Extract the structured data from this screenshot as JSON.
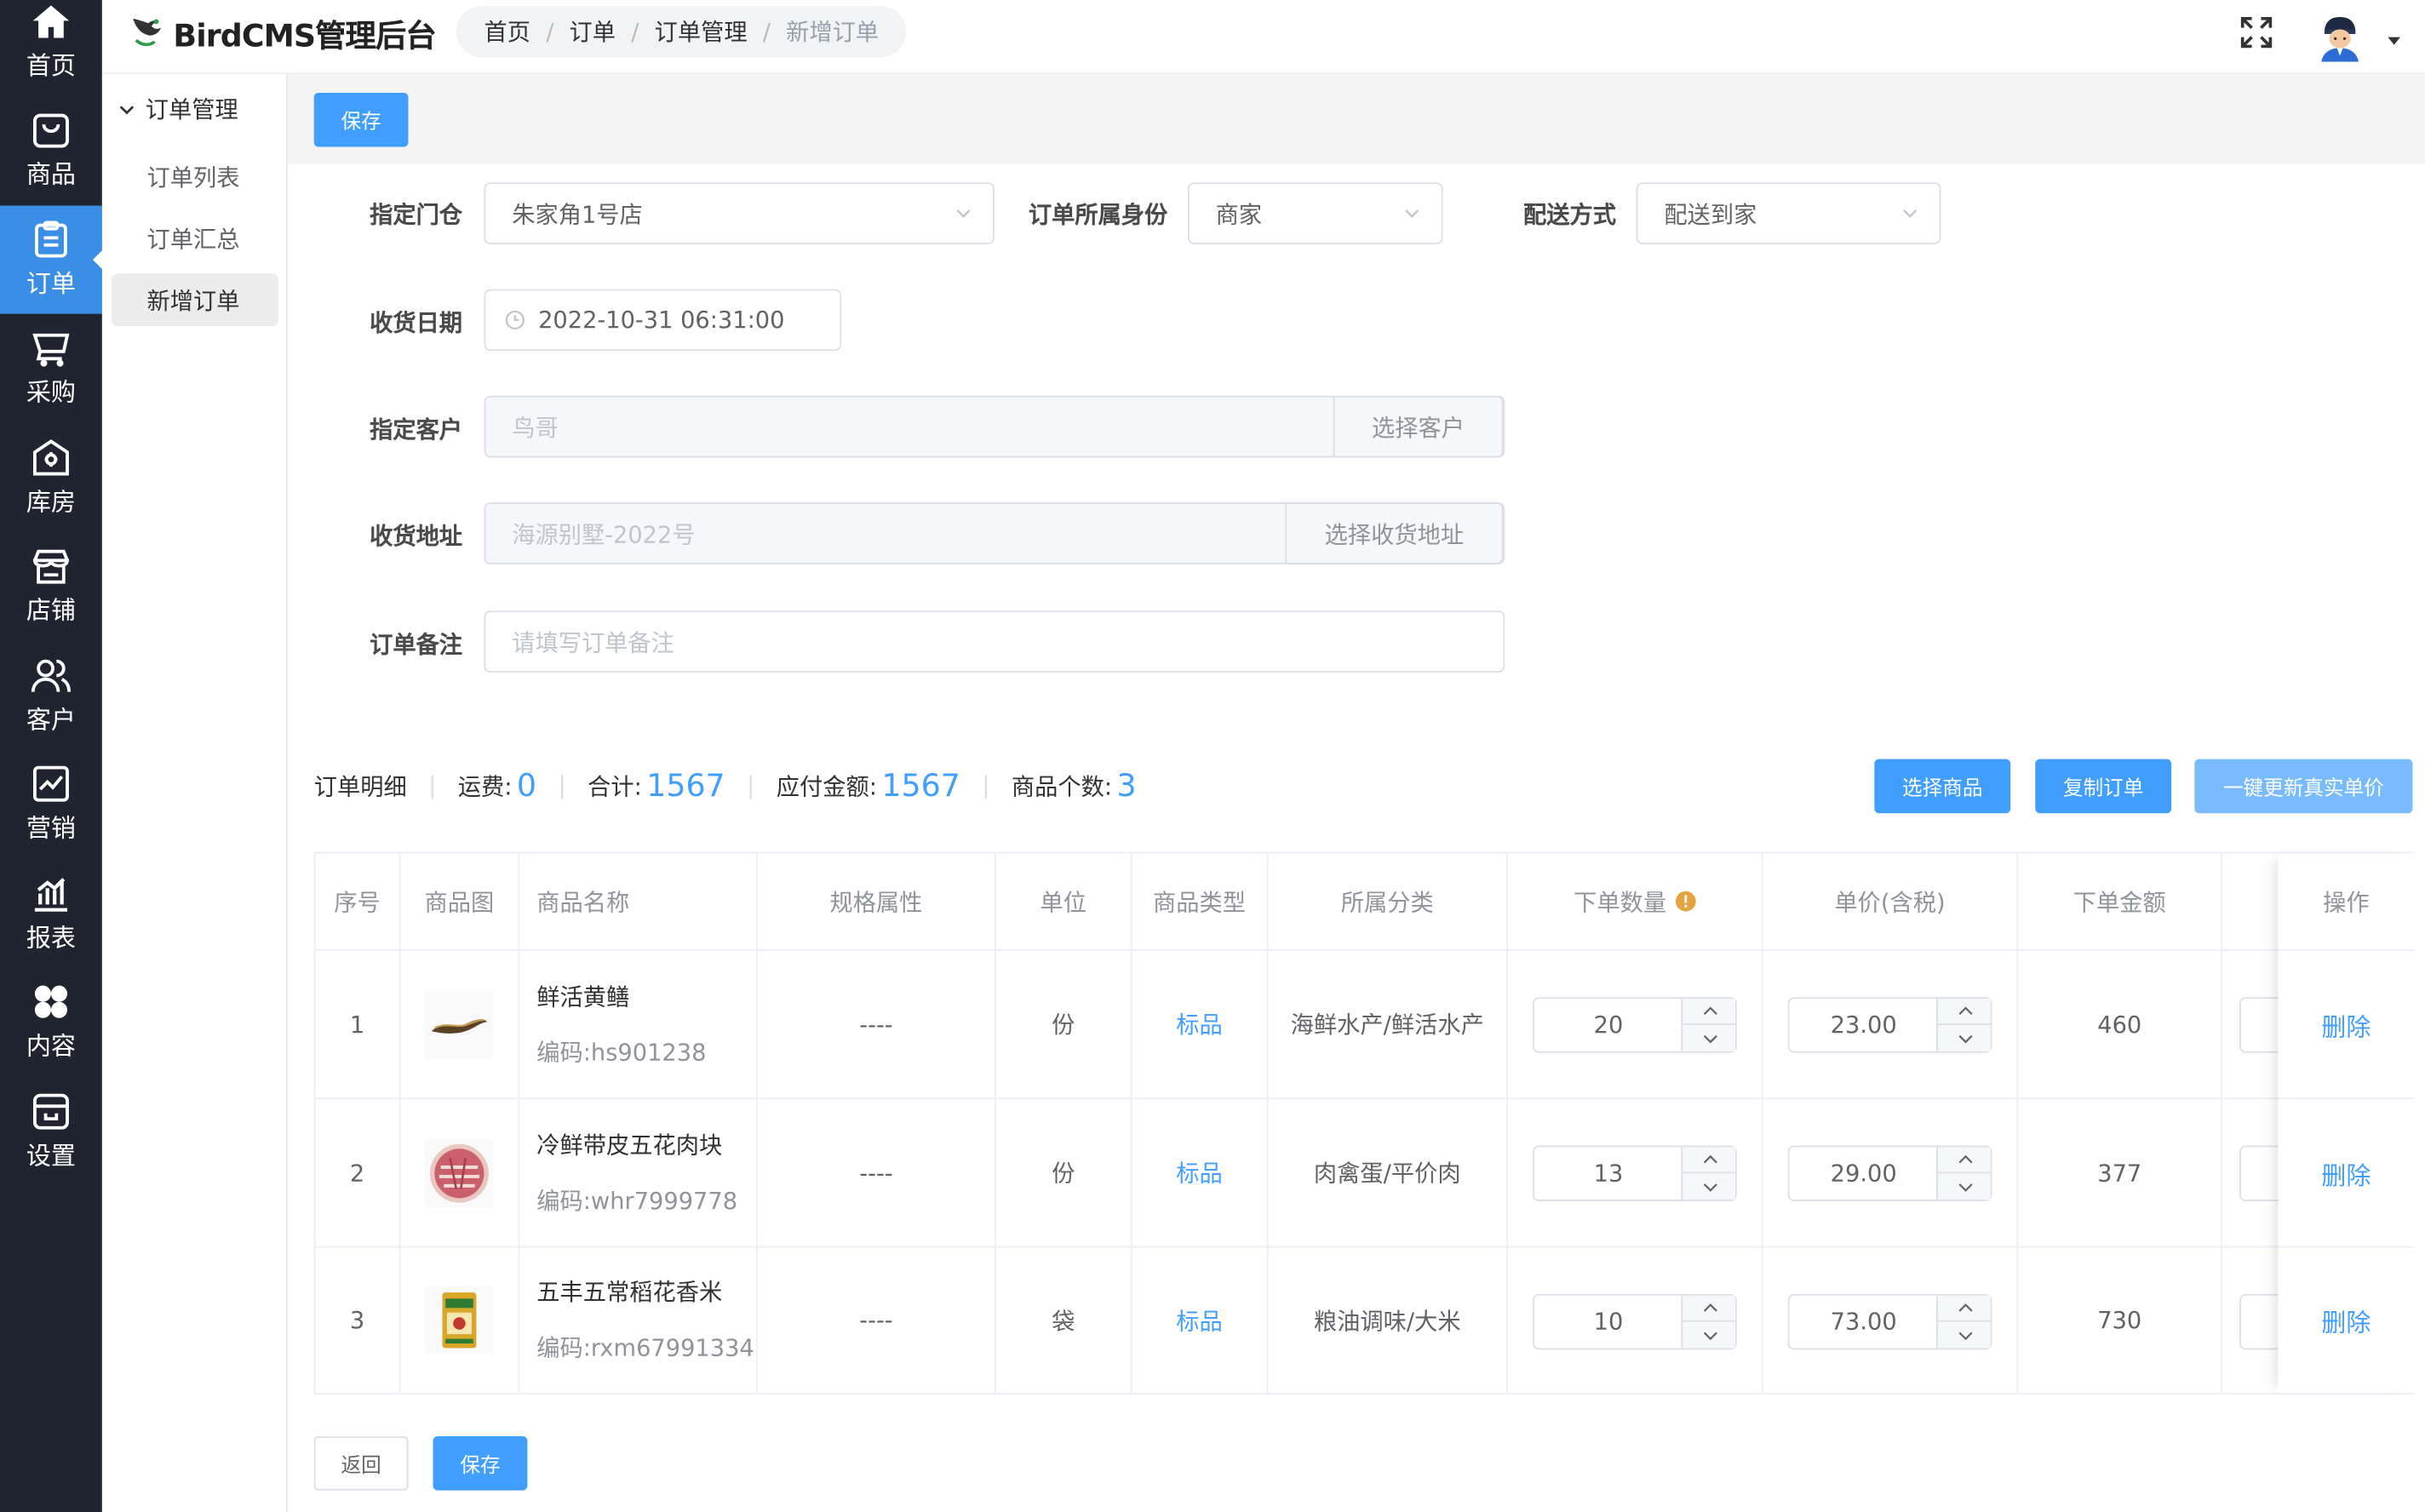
{
  "rail": [
    {
      "label": "首页",
      "icon": "home-icon"
    },
    {
      "label": "商品",
      "icon": "shopping-bag-icon"
    },
    {
      "label": "订单",
      "icon": "clipboard-icon",
      "active": true
    },
    {
      "label": "采购",
      "icon": "cart-icon"
    },
    {
      "label": "库房",
      "icon": "warehouse-icon"
    },
    {
      "label": "店铺",
      "icon": "store-icon"
    },
    {
      "label": "客户",
      "icon": "users-icon"
    },
    {
      "label": "营销",
      "icon": "trend-chart-icon"
    },
    {
      "label": "报表",
      "icon": "bar-chart-icon"
    },
    {
      "label": "内容",
      "icon": "grid-icon"
    },
    {
      "label": "设置",
      "icon": "settings-shop-icon"
    }
  ],
  "header": {
    "app_title": "BirdCMS管理后台",
    "breadcrumb": [
      "首页",
      "订单",
      "订单管理",
      "新增订单"
    ]
  },
  "subnav": {
    "group": "订单管理",
    "items": [
      "订单列表",
      "订单汇总",
      "新增订单"
    ]
  },
  "toolbar": {
    "save_label": "保存"
  },
  "form": {
    "store_label": "指定门仓",
    "store_value": "朱家角1号店",
    "identity_label": "订单所属身份",
    "identity_value": "商家",
    "delivery_label": "配送方式",
    "delivery_value": "配送到家",
    "date_label": "收货日期",
    "date_value": "2022-10-31 06:31:00",
    "customer_label": "指定客户",
    "customer_placeholder": "鸟哥",
    "customer_button": "选择客户",
    "address_label": "收货地址",
    "address_placeholder": "海源别墅-2022号",
    "address_button": "选择收货地址",
    "remark_label": "订单备注",
    "remark_placeholder": "请填写订单备注"
  },
  "summary": {
    "title": "订单明细",
    "freight_label": "运费:",
    "freight": "0",
    "total_label": "合计:",
    "total": "1567",
    "payable_label": "应付金额:",
    "payable": "1567",
    "count_label": "商品个数:",
    "count": "3",
    "select_goods": "选择商品",
    "copy_order": "复制订单",
    "update_price": "一键更新真实单价"
  },
  "table": {
    "headers": [
      "序号",
      "商品图",
      "商品名称",
      "规格属性",
      "单位",
      "商品类型",
      "所属分类",
      "下单数量",
      "单价(含税)",
      "下单金额",
      "操作"
    ],
    "rows": [
      {
        "index": "1",
        "name": "鲜活黄鳝",
        "code": "编码:hs901238",
        "spec": "----",
        "unit": "份",
        "type": "标品",
        "category": "海鲜水产/鲜活水产",
        "qty": "20",
        "price": "23.00",
        "amount": "460",
        "action": "删除"
      },
      {
        "index": "2",
        "name": "冷鲜带皮五花肉块",
        "code": "编码:whr7999778",
        "spec": "----",
        "unit": "份",
        "type": "标品",
        "category": "肉禽蛋/平价肉",
        "qty": "13",
        "price": "29.00",
        "amount": "377",
        "action": "删除"
      },
      {
        "index": "3",
        "name": "五丰五常稻花香米",
        "code": "编码:rxm67991334",
        "spec": "----",
        "unit": "袋",
        "type": "标品",
        "category": "粮油调味/大米",
        "qty": "10",
        "price": "73.00",
        "amount": "730",
        "action": "删除"
      }
    ]
  },
  "footer": {
    "back_label": "返回",
    "save_label": "保存"
  },
  "colors": {
    "primary": "#409eff",
    "rail_bg": "#1f2430",
    "rail_active": "#3a8ee6",
    "warning": "#e6a23c"
  }
}
